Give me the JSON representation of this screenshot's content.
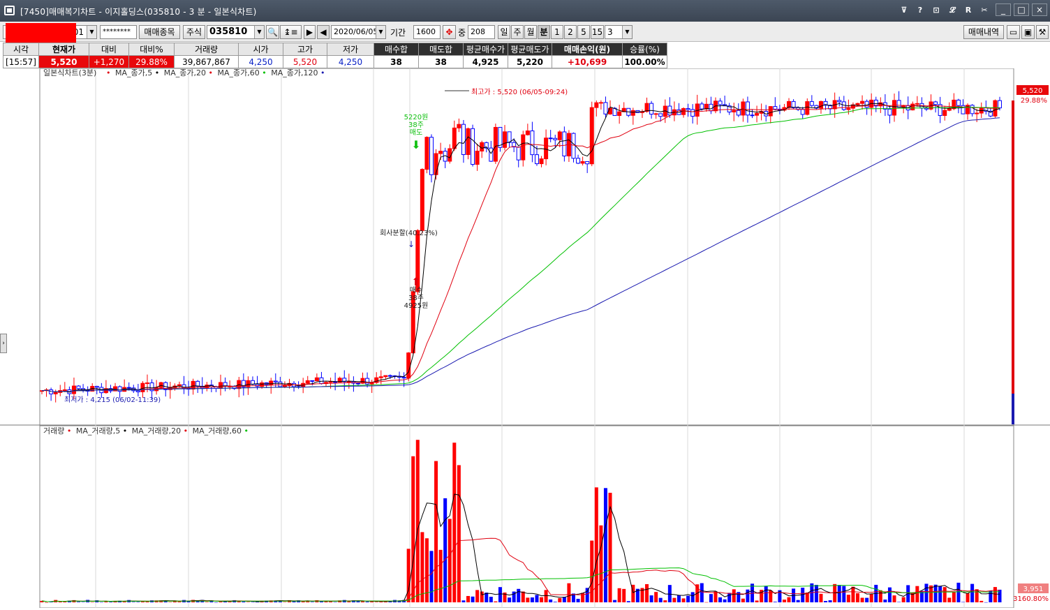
{
  "window": {
    "title": "[7450]매매복기차트 - 이지홀딩스(035810 - 3 분 - 일본식차트)",
    "icons": [
      "pin-icon",
      "help-icon",
      "layout-icon",
      "link-icon",
      "r-icon",
      "tool-icon"
    ],
    "icon_glyphs": [
      "⊽",
      "?",
      "⊡",
      "𝓛",
      "R",
      "✂"
    ],
    "controls": [
      "_",
      "□",
      "×"
    ]
  },
  "toolbar": {
    "account_suffix": "01",
    "password": "********",
    "trade_items_label": "매매종목",
    "market_type": "주식",
    "stock_code": "035810",
    "date": "2020/06/05",
    "period_label": "기간",
    "period_value": "1600",
    "count_label": "중",
    "count_value": "208",
    "period_buttons": [
      "일",
      "주",
      "월",
      "분"
    ],
    "selected_period": "분",
    "minute_buttons": [
      "1",
      "2",
      "5",
      "15"
    ],
    "minute_select": "3",
    "history_button": "매매내역"
  },
  "info": {
    "headers": [
      "시각",
      "현재가",
      "대비",
      "대비%",
      "거래량",
      "시가",
      "고가",
      "저가",
      "매수합",
      "매도합",
      "평균매수가",
      "평균매도가",
      "매매손익(원)",
      "승률(%)"
    ],
    "values": [
      "[15:57]",
      "5,520",
      "+1,270",
      "29.88%",
      "39,867,867",
      "4,250",
      "5,520",
      "4,250",
      "38",
      "38",
      "4,925",
      "5,220",
      "+10,699",
      "100.00%"
    ]
  },
  "price_chart": {
    "legend": "일본식차트(3분)",
    "ma_labels": [
      "MA_종가,5",
      "MA_종가,20",
      "MA_종가,60",
      "MA_종가,120"
    ],
    "ma_colors": [
      "#e0000f",
      "#000000",
      "#e0000f",
      "#00c000",
      "#1a1ab0"
    ],
    "high_annotation": "최고가 : 5,520 (06/05-09:24)",
    "low_annotation": "최저가 : 4,215 (06/02-11:39)",
    "sell_lines": [
      "5220원",
      "38주",
      "매도"
    ],
    "buy_lines": [
      "매수",
      "38주",
      "4925원"
    ],
    "split_annotation": "회사분할(40.23%)",
    "current_price_label": "5,520",
    "current_pct_label": "29.88%"
  },
  "volume_chart": {
    "legend": "거래량",
    "ma_labels": [
      "MA_거래량,5",
      "MA_거래량,20",
      "MA_거래량,60"
    ],
    "last_volume_label": "3,951",
    "last_pct_label": "3160.80%"
  },
  "colors": {
    "up": "#ff0000",
    "down": "#0000ff",
    "ma5": "#000000",
    "ma20": "#e0000f",
    "ma60": "#00c000",
    "ma120": "#1a1ab0",
    "grid": "#d9d9d9"
  },
  "chart_data": [
    {
      "type": "candlestick",
      "title": "일본식차트(3분)",
      "x_time": "3-minute bars",
      "ylim": [
        4215,
        5520
      ],
      "price_range": {
        "low": 4215,
        "high": 5520,
        "open": 4250,
        "last": 5520
      },
      "series": [
        {
          "name": "MA_종가,5",
          "values": []
        },
        {
          "name": "MA_종가,20",
          "values": []
        },
        {
          "name": "MA_종가,60",
          "values": []
        },
        {
          "name": "MA_종가,120",
          "values": []
        }
      ]
    },
    {
      "type": "bar",
      "title": "거래량",
      "last_value": 3951,
      "series": [
        {
          "name": "MA_거래량,5",
          "values": []
        },
        {
          "name": "MA_거래량,20",
          "values": []
        },
        {
          "name": "MA_거래량,60",
          "values": []
        }
      ]
    }
  ]
}
